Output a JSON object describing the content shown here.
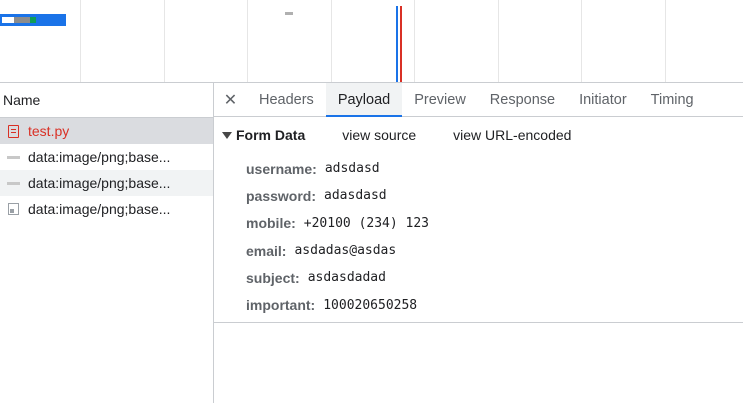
{
  "overview": {
    "colors": {
      "bar": "#1a73e8",
      "dom_content_loaded": "#1a73e8",
      "load": "#d93025"
    }
  },
  "name_column": {
    "header": "Name",
    "requests": [
      {
        "name": "test.py",
        "icon": "document-icon",
        "state": "selected-error"
      },
      {
        "name": "data:image/png;base...",
        "icon": "image-dash-icon",
        "state": "normal"
      },
      {
        "name": "data:image/png;base...",
        "icon": "image-dash-icon",
        "state": "alt"
      },
      {
        "name": "data:image/png;base...",
        "icon": "image-icon",
        "state": "normal"
      }
    ]
  },
  "details": {
    "close_icon": "close-icon",
    "tabs": [
      {
        "label": "Headers",
        "active": false
      },
      {
        "label": "Payload",
        "active": true
      },
      {
        "label": "Preview",
        "active": false
      },
      {
        "label": "Response",
        "active": false
      },
      {
        "label": "Initiator",
        "active": false
      },
      {
        "label": "Timing",
        "active": false
      }
    ],
    "payload": {
      "section_title": "Form Data",
      "view_source": "view source",
      "view_url_encoded": "view URL-encoded",
      "fields": [
        {
          "key": "username:",
          "value": "adsdasd"
        },
        {
          "key": "password:",
          "value": "adasdasd"
        },
        {
          "key": "mobile:",
          "value": "+20100 (234) 123"
        },
        {
          "key": "email:",
          "value": "asdadas@asdas"
        },
        {
          "key": "subject:",
          "value": "asdasdadad"
        },
        {
          "key": "important:",
          "value": "100020650258"
        }
      ]
    }
  }
}
